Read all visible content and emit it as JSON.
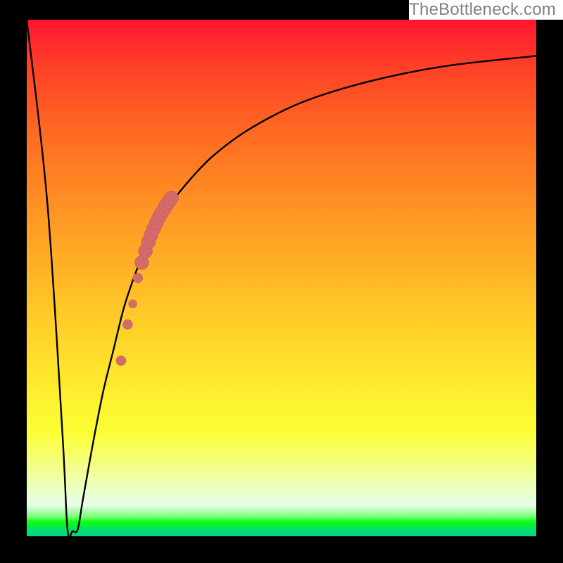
{
  "watermark": {
    "text": "TheBottleneck.com"
  },
  "colors": {
    "border": "#000000",
    "curve_stroke": "#000000",
    "marker_fill": "#d46a6a",
    "marker_stroke": "#bd5a5a"
  },
  "chart_data": {
    "type": "line",
    "title": "",
    "xlabel": "",
    "ylabel": "",
    "xlim": [
      0,
      100
    ],
    "ylim": [
      0,
      100
    ],
    "grid": false,
    "series": [
      {
        "name": "bottleneck-notch-curve",
        "x": [
          0,
          4,
          7,
          8,
          9,
          10,
          11,
          13,
          15,
          17,
          19,
          21,
          23,
          25,
          28,
          32,
          37,
          44,
          54,
          67,
          82,
          100
        ],
        "y": [
          100,
          65,
          20,
          1.3,
          1.0,
          1.3,
          7,
          18,
          28,
          36,
          44,
          50,
          55,
          59,
          64,
          69,
          74,
          79,
          84,
          88,
          91,
          93
        ]
      }
    ],
    "highlight_markers": {
      "name": "salmon-dots",
      "x": [
        18.5,
        19.8,
        20.8,
        21.8,
        22.6,
        23.3,
        23.9,
        24.4,
        24.9,
        25.4,
        25.9,
        26.4,
        26.9,
        27.4,
        27.9,
        28.4
      ],
      "y": [
        34.0,
        41.0,
        45.0,
        50.0,
        53.0,
        55.2,
        57.0,
        58.3,
        59.5,
        60.6,
        61.6,
        62.5,
        63.3,
        64.1,
        64.8,
        65.5
      ],
      "size": [
        7,
        7,
        6,
        7,
        10,
        10,
        10,
        10,
        10,
        10,
        10,
        10,
        10,
        10,
        10,
        10
      ]
    }
  }
}
